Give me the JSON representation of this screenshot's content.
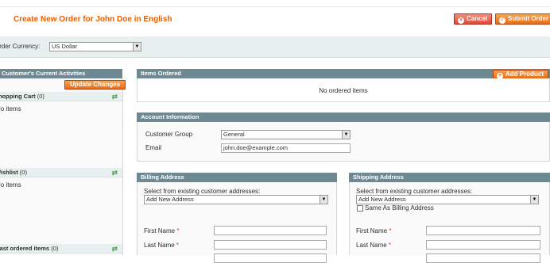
{
  "header": {
    "title": "Create New Order for John Doe in English",
    "cancel_label": "Cancel",
    "submit_label": "Submit Order"
  },
  "currency": {
    "label": "Order Currency:",
    "value": "US Dollar"
  },
  "sidebar": {
    "title": "Customer's Current Activities",
    "update_label": "Update Changes",
    "sections": [
      {
        "name": "Shopping Cart",
        "count": "(0)",
        "text": "No items"
      },
      {
        "name": "Wishlist",
        "count": "(0)",
        "text": "No items"
      },
      {
        "name": "Last ordered items",
        "count": "(0)",
        "text": ""
      }
    ]
  },
  "items": {
    "title": "Items Ordered",
    "add_label": "Add Product",
    "empty_text": "No ordered items"
  },
  "account": {
    "title": "Account Information",
    "group_label": "Customer Group",
    "group_value": "General",
    "email_label": "Email",
    "email_value": "john.doe@example.com"
  },
  "billing": {
    "title": "Billing Address",
    "select_label": "Select from existing customer addresses:",
    "select_value": "Add New Address",
    "first_name_label": "First Name",
    "last_name_label": "Last Name",
    "required_mark": "*"
  },
  "shipping": {
    "title": "Shipping Address",
    "select_label": "Select from existing customer addresses:",
    "select_value": "Add New Address",
    "same_as_label": "Same As Billing Address",
    "first_name_label": "First Name",
    "last_name_label": "Last Name",
    "required_mark": "*"
  }
}
